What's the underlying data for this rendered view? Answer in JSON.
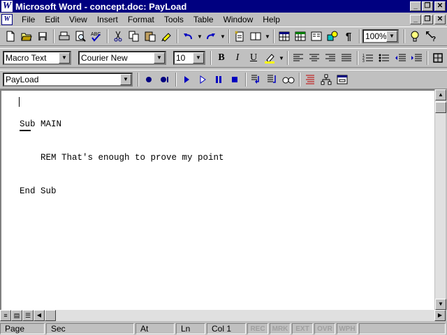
{
  "app": {
    "logo_letter": "W",
    "title": "Microsoft Word - concept.doc: PayLoad"
  },
  "menu": {
    "items": [
      {
        "key": "F",
        "rest": "ile"
      },
      {
        "key": "E",
        "rest": "dit"
      },
      {
        "key": "V",
        "rest": "iew"
      },
      {
        "key": "I",
        "rest": "nsert"
      },
      {
        "key": "",
        "rest": "Format",
        "mid_key": "o"
      },
      {
        "key": "T",
        "rest": "ools"
      },
      {
        "key": "",
        "rest": "Table",
        "mid_key": "a"
      },
      {
        "key": "W",
        "rest": "indow"
      },
      {
        "key": "H",
        "rest": "elp"
      }
    ],
    "labels": [
      "File",
      "Edit",
      "View",
      "Insert",
      "Format",
      "Tools",
      "Table",
      "Window",
      "Help"
    ]
  },
  "standard_toolbar": {
    "zoom": "100%",
    "icons": [
      "new-document-icon",
      "open-folder-icon",
      "save-icon",
      "print-icon",
      "print-preview-icon",
      "spelling-icon",
      "cut-icon",
      "copy-icon",
      "paste-icon",
      "format-painter-icon",
      "undo-icon",
      "redo-icon",
      "autoformat-icon",
      "insert-address-icon",
      "insert-table-icon",
      "insert-excel-icon",
      "columns-icon",
      "drawing-icon",
      "show-hide-icon",
      "tipwizard-icon",
      "help-icon"
    ]
  },
  "formatting_toolbar": {
    "style": "Macro Text",
    "font": "Courier New",
    "size": "10",
    "bold": "B",
    "italic": "I",
    "underline": "U"
  },
  "macro_toolbar": {
    "macro_name": "PayLoad"
  },
  "document": {
    "lines": [
      "Sub MAIN",
      "    REM That's enough to prove my point",
      "End Sub"
    ]
  },
  "statusbar": {
    "page": "Page",
    "sec": "Sec",
    "at": "At",
    "ln": "Ln",
    "col": "Col 1",
    "rec": "REC",
    "mrk": "MRK",
    "ext": "EXT",
    "ovr": "OVR",
    "wph": "WPH"
  },
  "colors": {
    "titlebar": "#000080",
    "chrome": "#c0c0c0",
    "accent_blue": "#0000c0"
  }
}
